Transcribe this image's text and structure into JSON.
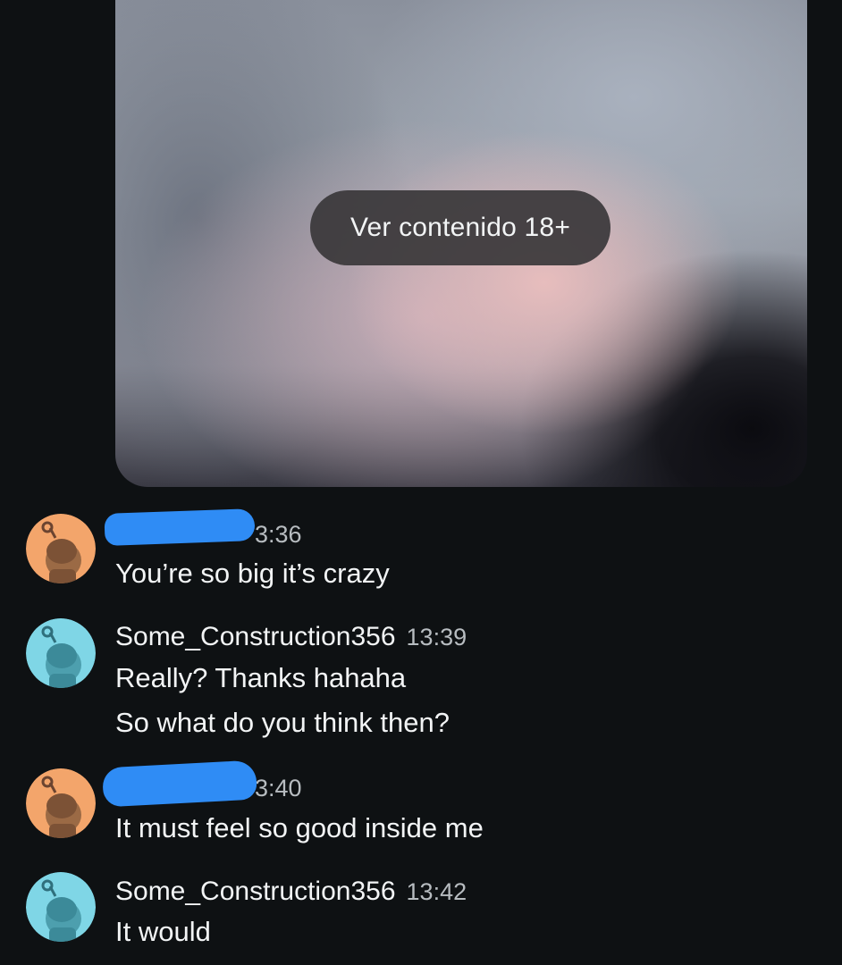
{
  "media": {
    "nsfw_button_label": "Ver contenido 18+"
  },
  "messages": [
    {
      "username": "",
      "time": "3:36",
      "avatar_color": "#f3a56b",
      "avatar_icon": "snoo-avatar-orange",
      "lines": [
        "You’re so big it’s crazy"
      ]
    },
    {
      "username": "Some_Construction356",
      "time": "13:39",
      "avatar_color": "#7fd6e6",
      "avatar_icon": "snoo-avatar-cyan",
      "lines": [
        "Really? Thanks hahaha",
        "So what do you think then?"
      ]
    },
    {
      "username": "",
      "time": "3:40",
      "avatar_color": "#f3a56b",
      "avatar_icon": "snoo-avatar-orange",
      "lines": [
        "It must feel so good inside me"
      ]
    },
    {
      "username": "Some_Construction356",
      "time": "13:42",
      "avatar_color": "#7fd6e6",
      "avatar_icon": "snoo-avatar-cyan",
      "lines": [
        "It would"
      ]
    }
  ],
  "colors": {
    "background": "#0e1113",
    "redaction": "#2f8cf5",
    "timestamp": "#b7bcc0"
  }
}
